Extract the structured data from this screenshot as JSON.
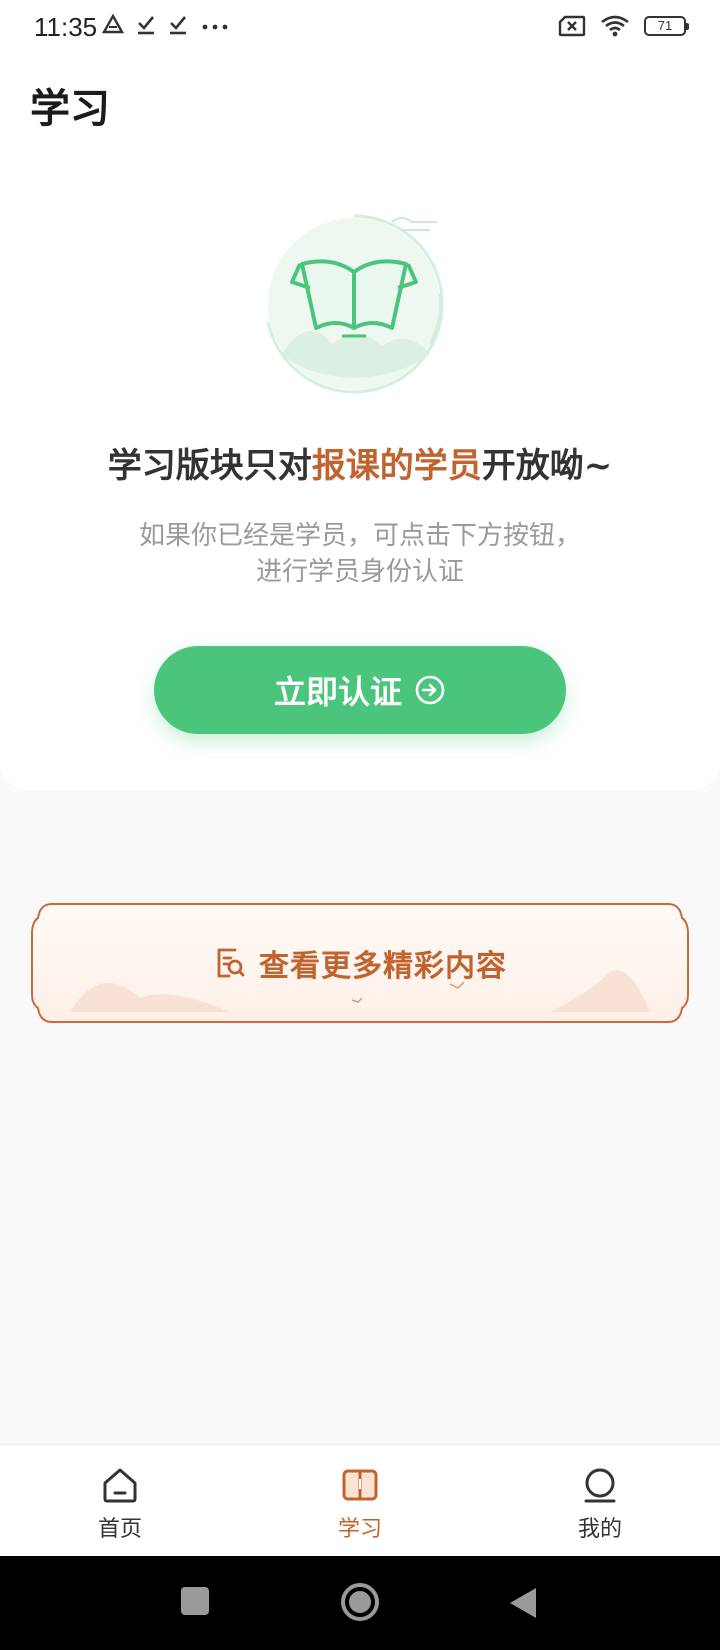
{
  "status_bar": {
    "time": "11:35",
    "battery": "71",
    "left_icons": [
      "drive-icon",
      "download-done-icon",
      "download-done-icon",
      "more-dots-icon"
    ],
    "right_icons": [
      "no-sim-icon",
      "wifi-icon",
      "battery-icon"
    ]
  },
  "page": {
    "title": "学习"
  },
  "notice": {
    "headline_pre": "学习版块只对",
    "headline_highlight": "报课的学员",
    "headline_post": "开放呦~",
    "desc_line1": "如果你已经是学员，可点击下方按钮，",
    "desc_line2": "进行学员身份认证"
  },
  "verify_button": {
    "label": "立即认证"
  },
  "banner": {
    "label": "查看更多精彩内容"
  },
  "bottom_nav": {
    "items": [
      {
        "label": "首页",
        "icon": "home-icon",
        "active": false
      },
      {
        "label": "学习",
        "icon": "book-icon",
        "active": true
      },
      {
        "label": "我的",
        "icon": "profile-icon",
        "active": false
      }
    ]
  },
  "colors": {
    "accent_green": "#4cc57c",
    "accent_orange": "#c0632f",
    "background": "#f9f9f9"
  }
}
